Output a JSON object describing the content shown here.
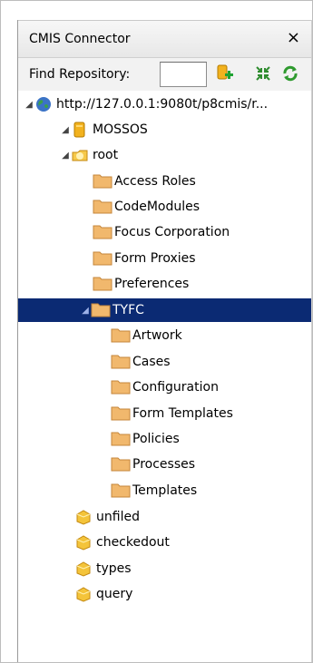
{
  "panel": {
    "title": "CMIS Connector",
    "close_glyph": "×",
    "find_label": "Find Repository:",
    "find_value": "",
    "toolbar_icons": [
      "add-repository-icon",
      "collapse-icon",
      "refresh-icon"
    ]
  },
  "tree": {
    "server": "http://127.0.0.1:9080t/p8cmis/r...",
    "repository": "MOSSOS",
    "root": "root",
    "root_folders": [
      "Access Roles",
      "CodeModules",
      "Focus Corporation",
      "Form Proxies",
      "Preferences"
    ],
    "selected": "TYFC",
    "tyfc_children": [
      "Artwork",
      "Cases",
      "Configuration",
      "Form Templates",
      "Policies",
      "Processes",
      "Templates"
    ],
    "special": [
      "unfiled",
      "checkedout",
      "types",
      "query"
    ]
  },
  "colors": {
    "selection": "#0b2a73",
    "folder": "#f1b86d",
    "repository": "#f2b21e",
    "globe": "#3aa14b"
  }
}
